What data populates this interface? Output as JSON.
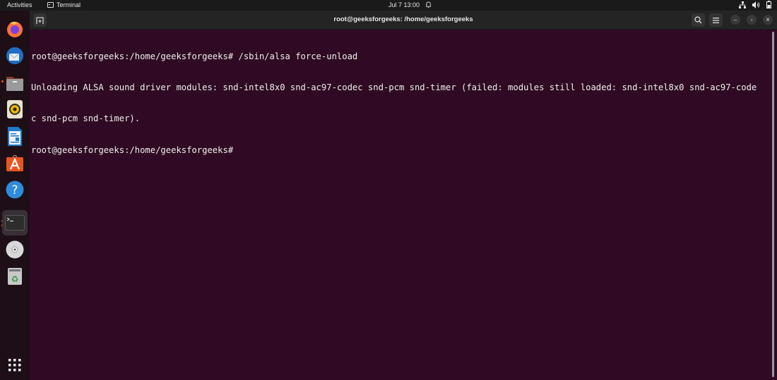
{
  "topbar": {
    "activities": "Activities",
    "app_name": "Terminal",
    "clock": "Jul 7  13:00",
    "tray_icons": [
      "network-icon",
      "volume-icon",
      "battery-icon"
    ]
  },
  "dock": {
    "items": [
      {
        "name": "firefox",
        "icon": "firefox-icon"
      },
      {
        "name": "thunderbird",
        "icon": "thunderbird-icon"
      },
      {
        "name": "files",
        "icon": "files-icon",
        "running": true
      },
      {
        "name": "rhythmbox",
        "icon": "rhythmbox-icon"
      },
      {
        "name": "libreoffice-writer",
        "icon": "writer-icon"
      },
      {
        "name": "software",
        "icon": "software-icon"
      },
      {
        "name": "help",
        "icon": "help-icon"
      },
      {
        "name": "terminal",
        "icon": "terminal-icon",
        "running": true,
        "active": true
      },
      {
        "name": "dvd",
        "icon": "disc-icon"
      },
      {
        "name": "trash",
        "icon": "trash-icon"
      }
    ],
    "show_apps": "apps-grid-icon"
  },
  "window": {
    "title": "root@geeksforgeeks: /home/geeksforgeeks",
    "buttons": {
      "new_tab": "new-tab-icon",
      "search": "search-icon",
      "menu": "hamburger-menu-icon",
      "minimize": "–",
      "maximize": "▫",
      "close": "×"
    }
  },
  "terminal": {
    "lines": [
      "root@geeksforgeeks:/home/geeksforgeeks# /sbin/alsa force-unload",
      "Unloading ALSA sound driver modules: snd-intel8x0 snd-ac97-codec snd-pcm snd-timer (failed: modules still loaded: snd-intel8x0 snd-ac97-code",
      "c snd-pcm snd-timer).",
      "root@geeksforgeeks:/home/geeksforgeeks# "
    ]
  }
}
